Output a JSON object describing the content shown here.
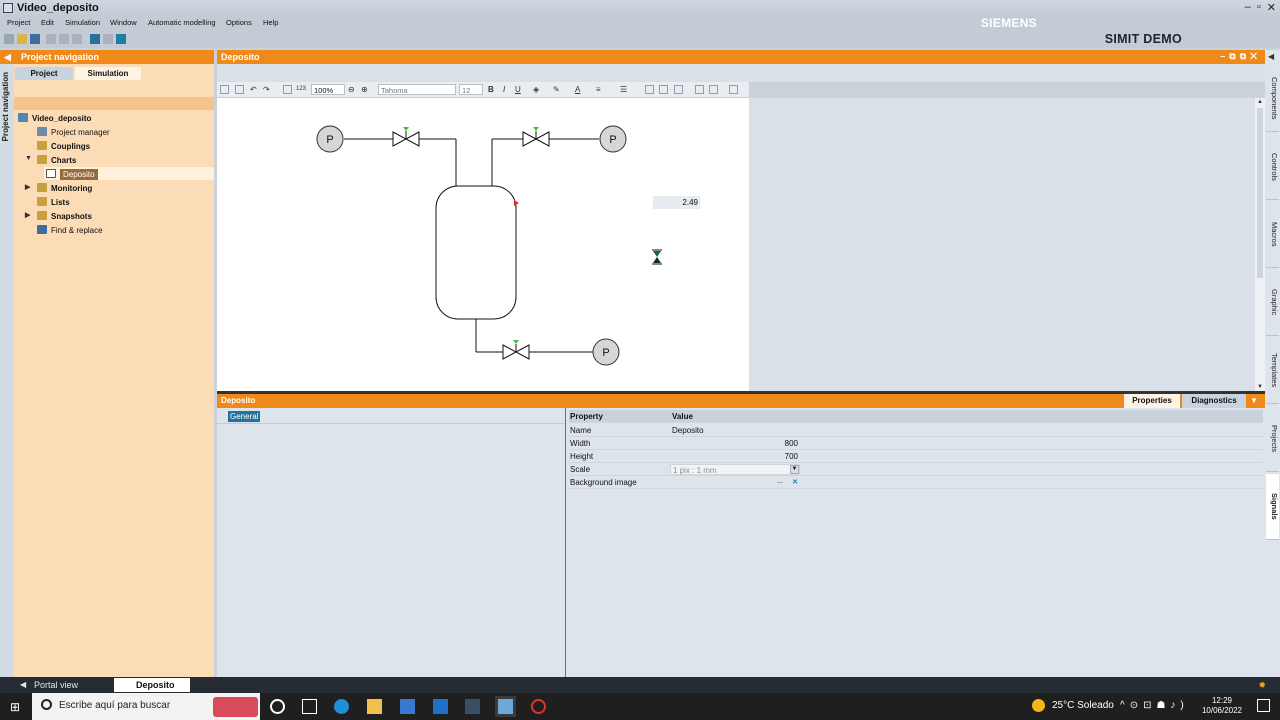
{
  "window": {
    "title": "Video_deposito"
  },
  "menu": [
    "Project",
    "Edit",
    "Simulation",
    "Window",
    "Automatic modelling",
    "Options",
    "Help"
  ],
  "brand": {
    "company": "SIEMENS",
    "product": "SIMIT DEMO"
  },
  "project_nav": {
    "title": "Project navigation",
    "side_label": "Project navigation",
    "tabs": [
      "Project",
      "Simulation"
    ],
    "active_tab": "Simulation",
    "tree": {
      "root": "Video_deposito",
      "items": [
        "Project manager",
        "Couplings",
        "Charts",
        "Deposito",
        "Monitoring",
        "Lists",
        "Snapshots",
        "Find & replace"
      ]
    }
  },
  "editor": {
    "title": "Deposito",
    "zoom": "100%",
    "font": "Tahoma",
    "font_size": "12",
    "fmt_labels": {
      "bold": "B",
      "italic": "I",
      "underline": "U",
      "num": "123"
    },
    "diagram": {
      "pump_label": "P",
      "level_value": "2.49"
    }
  },
  "properties": {
    "panel_title": "Deposito",
    "tabs": [
      "Properties",
      "Diagnostics"
    ],
    "active_tab": "Properties",
    "section": "General",
    "columns": [
      "Property",
      "Value"
    ],
    "rows": [
      {
        "key": "Name",
        "value": "Deposito"
      },
      {
        "key": "Width",
        "value": "800"
      },
      {
        "key": "Height",
        "value": "700"
      },
      {
        "key": "Scale",
        "value": "1 pix : 1 mm"
      },
      {
        "key": "Background image",
        "value": ""
      }
    ],
    "bg_buttons": {
      "browse": "...",
      "clear": "✕"
    }
  },
  "right_tabs": [
    "Components",
    "Controls",
    "Macros",
    "Graphic",
    "Templates",
    "Projects",
    "Signals"
  ],
  "portal": {
    "portal_view": "Portal view",
    "open_tab": "Deposito"
  },
  "taskbar": {
    "search_placeholder": "Escribe aquí para buscar",
    "weather": "25°C  Soleado",
    "time": "12:29",
    "date": "10/06/2022"
  },
  "colors": {
    "accent_orange": "#ef8a1a",
    "nav_bg": "#fbdcb6",
    "pump_fill": "#d6d6d6",
    "valve_indicator": "#3fc13f"
  }
}
